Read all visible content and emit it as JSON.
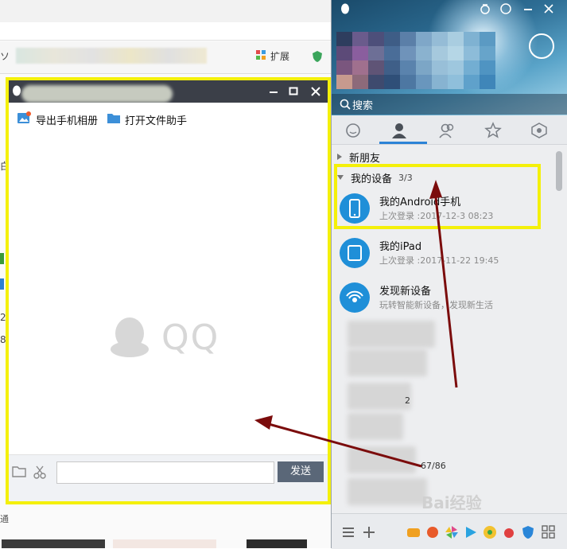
{
  "browser": {
    "extensions_label": "扩展",
    "left_edge_chars": [
      "ソ",
      "白",
      "2",
      "8"
    ],
    "status_tail": "通"
  },
  "chat_window": {
    "title": "",
    "toolbar": {
      "export_album_label": "导出手机相册",
      "open_file_helper_label": "打开文件助手"
    },
    "logo_text": "QQ",
    "input_value": "",
    "send_label": "发送",
    "icons": [
      "qq-penguin-icon",
      "minimize-icon",
      "maximize-icon",
      "close-icon",
      "image-export-icon",
      "folder-icon",
      "scissors-icon"
    ]
  },
  "qq_panel": {
    "search_label": "搜索",
    "tabs": [
      "chat-tab",
      "contacts-tab",
      "groups-tab",
      "favorites-tab",
      "space-tab"
    ],
    "groups": {
      "new_friends": "新朋友",
      "my_devices": "我的设备",
      "my_devices_count": "3/3"
    },
    "devices": [
      {
        "name": "我的Android手机",
        "sub": "上次登录 :2017-12-3 08:23"
      },
      {
        "name": "我的iPad",
        "sub": "上次登录 :2017-11-22 19:45"
      },
      {
        "name": "发现新设备",
        "sub": "玩转智能新设备，发现新生活"
      }
    ],
    "partial_counts": [
      "2",
      "67/86"
    ]
  },
  "watermark": "Bai经验",
  "colors": {
    "highlight": "#f4f00a",
    "arrow": "#7b0c0c",
    "title_bar": "#3b3f48",
    "accent": "#1f8fd8"
  }
}
